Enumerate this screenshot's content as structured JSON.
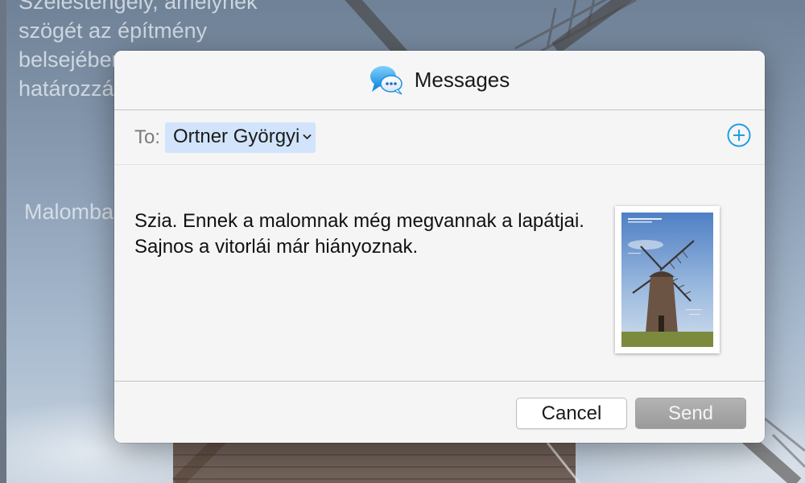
{
  "background": {
    "paragraph_lines": [
      "Szélestengely, amelynek",
      "szögét az építmény",
      "belsejében lévő szerkezettel",
      "határozzák meg."
    ],
    "caption": "Malomban"
  },
  "sheet": {
    "app_icon": "messages-bubble-icon",
    "title": "Messages",
    "to_label": "To:",
    "recipient": "Ortner Györgyi",
    "add_icon": "plus-circle-icon",
    "message": "Szia. Ennek a malomnak még megvannak a lapátjai. Sajnos a vitorlái már hiányoznak.",
    "attachment_icon": "document-thumbnail",
    "cancel_label": "Cancel",
    "send_label": "Send",
    "colors": {
      "accent": "#1e9fe3",
      "token_bg": "#d1e4fb",
      "send_disabled": "#a6a6a6"
    }
  }
}
